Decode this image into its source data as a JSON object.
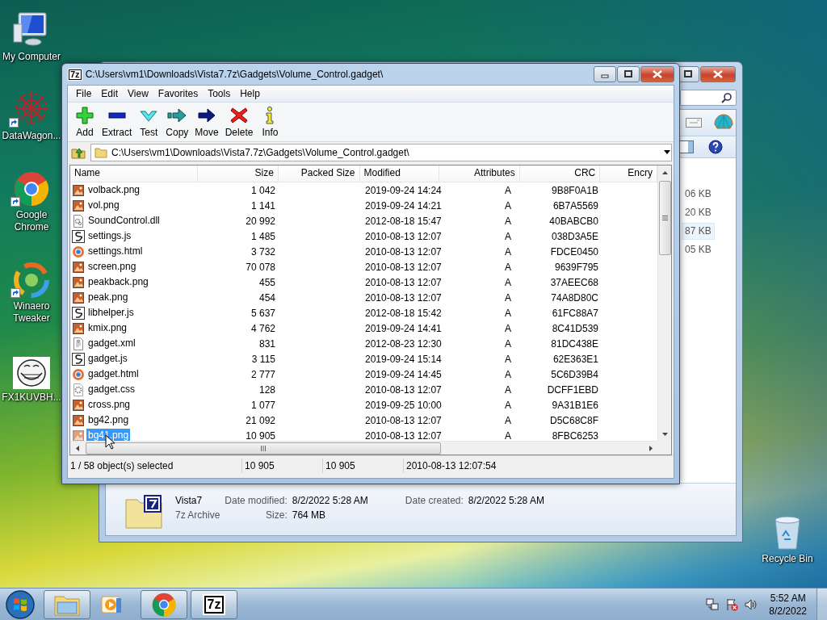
{
  "desktop_icons": [
    {
      "label": "My Computer",
      "kind": "computer",
      "shortcut": false
    },
    {
      "label": "DataWagon...",
      "kind": "star",
      "shortcut": true
    },
    {
      "label": "Google Chrome",
      "kind": "chrome",
      "shortcut": true
    },
    {
      "label": "Winaero Tweaker",
      "kind": "swirl",
      "shortcut": true
    },
    {
      "label": "FX1KUVBH...",
      "kind": "face",
      "shortcut": false
    }
  ],
  "explorer": {
    "sizes": [
      {
        "text": "06 KB",
        "selected": false
      },
      {
        "text": "20 KB",
        "selected": false
      },
      {
        "text": "87 KB",
        "selected": true
      },
      {
        "text": "05 KB",
        "selected": false
      }
    ],
    "details": {
      "name": "Vista7",
      "type": "7z Archive",
      "fields": [
        {
          "label": "Date modified:",
          "value": "8/2/2022 5:28 AM"
        },
        {
          "label": "Size:",
          "value": "764 MB"
        },
        {
          "label": "Date created:",
          "value": "8/2/2022 5:28 AM"
        }
      ]
    }
  },
  "archive_window": {
    "app_icon": "7z",
    "title": "C:\\Users\\vm1\\Downloads\\Vista7.7z\\Gadgets\\Volume_Control.gadget\\",
    "menu": [
      "File",
      "Edit",
      "View",
      "Favorites",
      "Tools",
      "Help"
    ],
    "toolbar": [
      {
        "label": "Add",
        "kind": "add"
      },
      {
        "label": "Extract",
        "kind": "extract"
      },
      {
        "label": "Test",
        "kind": "test"
      },
      {
        "label": "Copy",
        "kind": "copy"
      },
      {
        "label": "Move",
        "kind": "move"
      },
      {
        "label": "Delete",
        "kind": "delete"
      },
      {
        "label": "Info",
        "kind": "info"
      }
    ],
    "address": "C:\\Users\\vm1\\Downloads\\Vista7.7z\\Gadgets\\Volume_Control.gadget\\",
    "columns": [
      "Name",
      "Size",
      "Packed Size",
      "Modified",
      "Attributes",
      "CRC",
      "Encry"
    ],
    "rows": [
      {
        "name": "volback.png",
        "kind": "image",
        "size": "1 042",
        "modified": "2019-09-24 14:24",
        "attributes": "A",
        "crc": "9B8F0A1B",
        "selected": false
      },
      {
        "name": "vol.png",
        "kind": "image",
        "size": "1 141",
        "modified": "2019-09-24 14:21",
        "attributes": "A",
        "crc": "6B7A5569",
        "selected": false
      },
      {
        "name": "SoundControl.dll",
        "kind": "dll",
        "size": "20 992",
        "modified": "2012-08-18 15:47",
        "attributes": "A",
        "crc": "40BABCB0",
        "selected": false
      },
      {
        "name": "settings.js",
        "kind": "script",
        "size": "1 485",
        "modified": "2010-08-13 12:07",
        "attributes": "A",
        "crc": "038D3A5E",
        "selected": false
      },
      {
        "name": "settings.html",
        "kind": "html",
        "size": "3 732",
        "modified": "2010-08-13 12:07",
        "attributes": "A",
        "crc": "FDCE0450",
        "selected": false
      },
      {
        "name": "screen.png",
        "kind": "image",
        "size": "70 078",
        "modified": "2010-08-13 12:07",
        "attributes": "A",
        "crc": "9639F795",
        "selected": false
      },
      {
        "name": "peakback.png",
        "kind": "image",
        "size": "455",
        "modified": "2010-08-13 12:07",
        "attributes": "A",
        "crc": "37AEEC68",
        "selected": false
      },
      {
        "name": "peak.png",
        "kind": "image",
        "size": "454",
        "modified": "2010-08-13 12:07",
        "attributes": "A",
        "crc": "74A8D80C",
        "selected": false
      },
      {
        "name": "libhelper.js",
        "kind": "script",
        "size": "5 637",
        "modified": "2012-08-18 15:42",
        "attributes": "A",
        "crc": "61FC88A7",
        "selected": false
      },
      {
        "name": "kmix.png",
        "kind": "image",
        "size": "4 762",
        "modified": "2019-09-24 14:41",
        "attributes": "A",
        "crc": "8C41D539",
        "selected": false
      },
      {
        "name": "gadget.xml",
        "kind": "xml",
        "size": "831",
        "modified": "2012-08-23 12:30",
        "attributes": "A",
        "crc": "81DC438E",
        "selected": false
      },
      {
        "name": "gadget.js",
        "kind": "script",
        "size": "3 115",
        "modified": "2019-09-24 15:14",
        "attributes": "A",
        "crc": "62E363E1",
        "selected": false
      },
      {
        "name": "gadget.html",
        "kind": "html",
        "size": "2 777",
        "modified": "2019-09-24 14:45",
        "attributes": "A",
        "crc": "5C6D39B4",
        "selected": false
      },
      {
        "name": "gadget.css",
        "kind": "css",
        "size": "128",
        "modified": "2010-08-13 12:07",
        "attributes": "A",
        "crc": "DCFF1EBD",
        "selected": false
      },
      {
        "name": "cross.png",
        "kind": "image",
        "size": "1 077",
        "modified": "2019-09-25 10:00",
        "attributes": "A",
        "crc": "9A31B1E6",
        "selected": false
      },
      {
        "name": "bg42.png",
        "kind": "image",
        "size": "21 092",
        "modified": "2010-08-13 12:07",
        "attributes": "A",
        "crc": "D5C68C8F",
        "selected": false
      },
      {
        "name": "bg41.png",
        "kind": "image",
        "size": "10 905",
        "modified": "2010-08-13 12:07",
        "attributes": "A",
        "crc": "8FBC6253",
        "selected": true
      }
    ],
    "status": [
      "1 / 58 object(s) selected",
      "10 905",
      "10 905",
      "2010-08-13 12:07:54"
    ]
  },
  "recycle_bin": {
    "label": "Recycle Bin"
  },
  "taskbar": {
    "buttons": [
      {
        "kind": "explorer",
        "running": true
      },
      {
        "kind": "media",
        "running": false
      },
      {
        "kind": "chrome",
        "running": true
      },
      {
        "kind": "archiver",
        "running": true,
        "text": "7z"
      }
    ],
    "time": "5:52 AM",
    "date": "8/2/2022"
  }
}
